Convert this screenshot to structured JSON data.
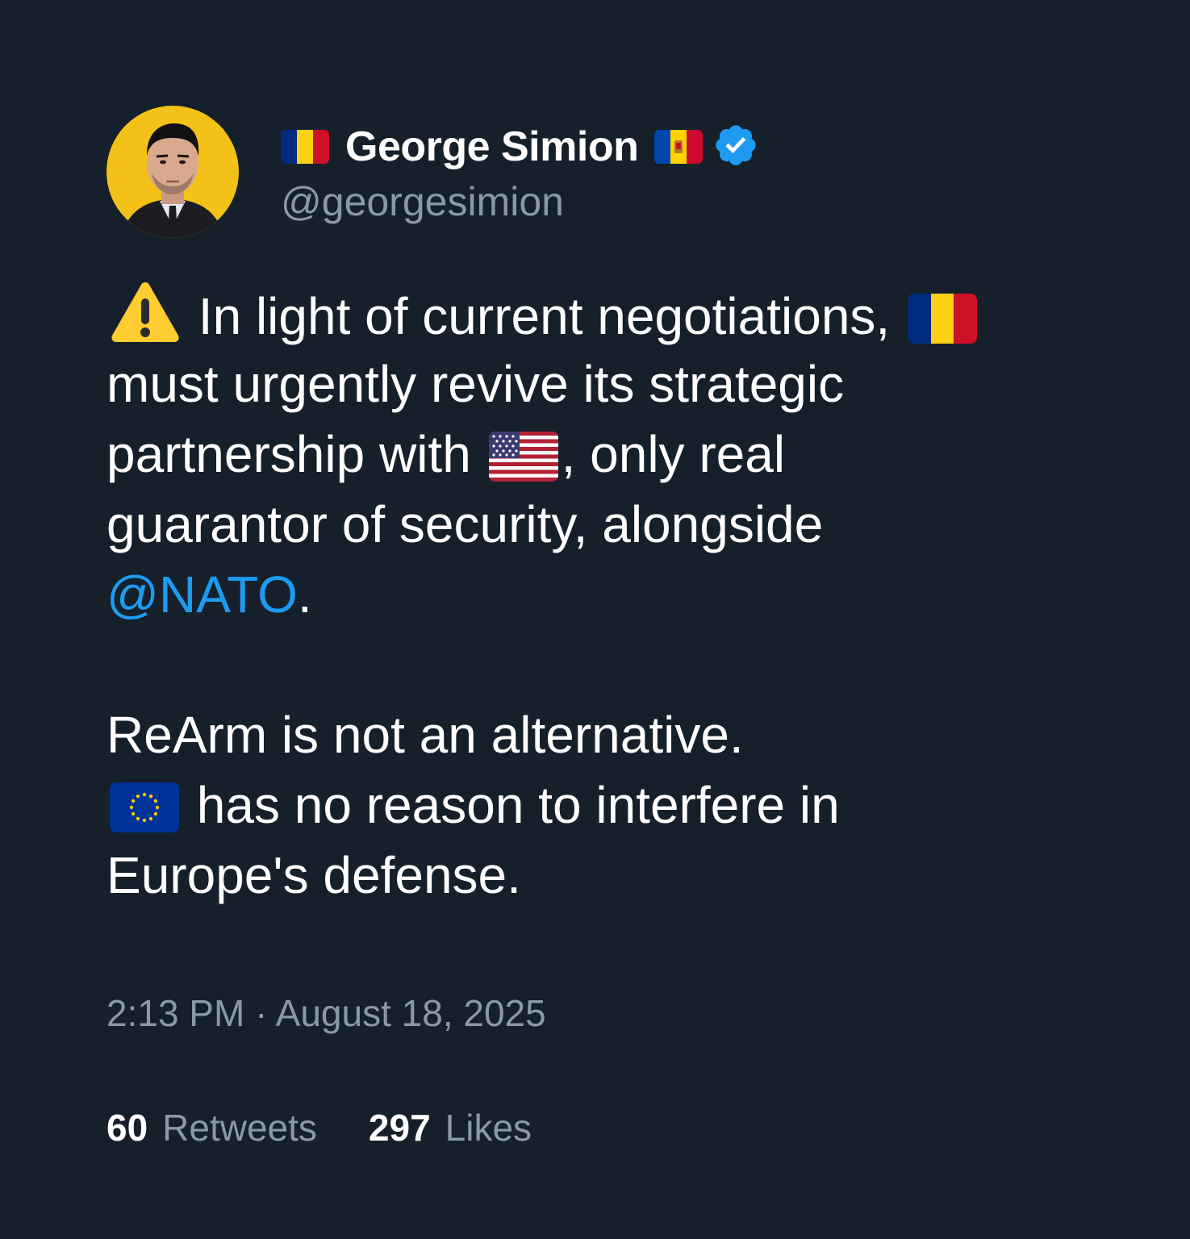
{
  "author": {
    "display_name": "George Simion",
    "handle": "@georgesimion",
    "verified": true,
    "name_prefix_icon": "romania-flag-icon",
    "name_suffix_icon": "moldova-flag-icon"
  },
  "tweet": {
    "segments": {
      "l1_text": "In light of current negotiations,",
      "l2_text": "must urgently revive its strategic",
      "l3_a": "partnership with",
      "l3_b": ", only real",
      "l4_text": "guarantor of security, alongside",
      "l5_mention": "@NATO",
      "l5_tail": ".",
      "l6_text": "ReArm is not an alternative.",
      "l7_text": "has no reason to interfere in",
      "l8_text": "Europe's defense."
    },
    "emoji": [
      "warning-icon",
      "romania-flag-icon",
      "usa-flag-icon",
      "eu-flag-icon"
    ]
  },
  "timestamp": "2:13 PM · August 18, 2025",
  "stats": {
    "retweets_count": "60",
    "retweets_label": "Retweets",
    "likes_count": "297",
    "likes_label": "Likes"
  },
  "colors": {
    "background": "#15202b",
    "text": "#ffffff",
    "secondary": "#8b98a5",
    "link": "#1d9bf0",
    "verified": "#1d9bf0",
    "avatar_bg": "#f4c118"
  }
}
